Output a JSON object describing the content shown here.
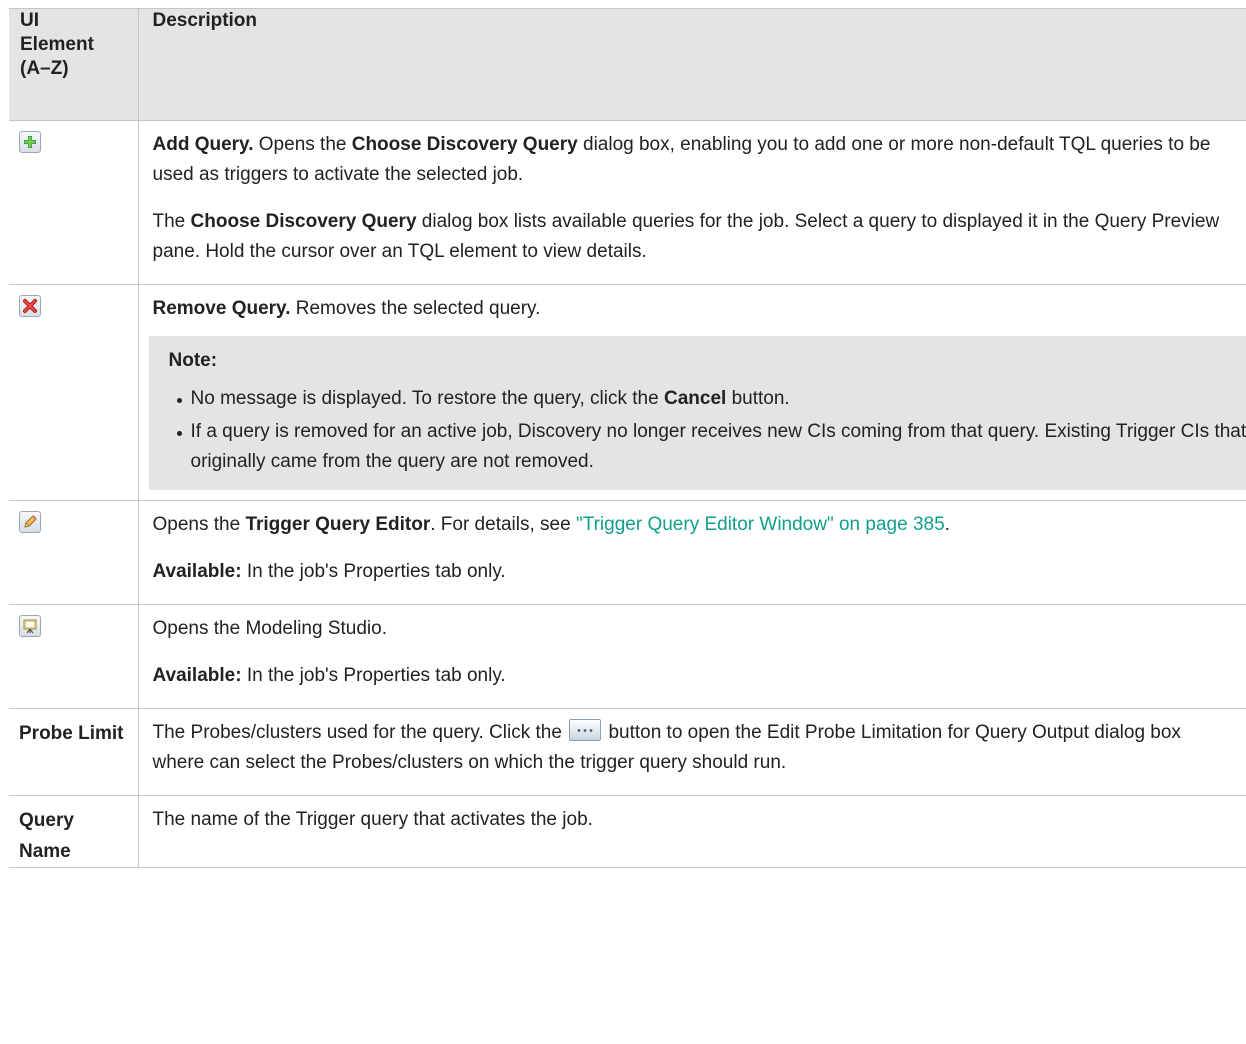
{
  "header": {
    "element_col": "UI Element (A–Z)",
    "description_col": "Description"
  },
  "rows": [
    {
      "icon": "add-query-icon",
      "lines": [
        {
          "segments": [
            {
              "t": "Add Query.",
              "b": true
            },
            {
              "t": " Opens the "
            },
            {
              "t": "Choose Discovery Query",
              "b": true
            },
            {
              "t": " dialog box, enabling you to add one or more non-default TQL queries to be used as triggers to activate the selected job."
            }
          ]
        },
        {
          "segments": [
            {
              "t": "The "
            },
            {
              "t": "Choose Discovery Query",
              "b": true
            },
            {
              "t": " dialog box lists available queries for the job. Select a query to displayed it in the Query Preview pane. Hold the cursor over an TQL element to view details."
            }
          ]
        }
      ]
    },
    {
      "icon": "remove-query-icon",
      "lines": [
        {
          "segments": [
            {
              "t": "Remove Query.",
              "b": true
            },
            {
              "t": " Removes the selected query."
            }
          ]
        }
      ],
      "note": {
        "title": "Note:",
        "items": [
          {
            "segments": [
              {
                "t": "No message is displayed. To restore the query, click the "
              },
              {
                "t": "Cancel",
                "b": true
              },
              {
                "t": " button."
              }
            ]
          },
          {
            "segments": [
              {
                "t": "If a query is removed for an active job, Discovery no longer receives new CIs coming from that query. Existing Trigger CIs that originally came from the query are not removed."
              }
            ]
          }
        ]
      }
    },
    {
      "icon": "edit-pencil-icon",
      "lines": [
        {
          "segments": [
            {
              "t": "Opens the "
            },
            {
              "t": "Trigger Query Editor",
              "b": true
            },
            {
              "t": ". For details, see "
            },
            {
              "t": "\"Trigger Query Editor Window\" on page 385",
              "link": true
            },
            {
              "t": "."
            }
          ]
        },
        {
          "segments": [
            {
              "t": "Available:",
              "b": true
            },
            {
              "t": " In the job's Properties tab only."
            }
          ]
        }
      ]
    },
    {
      "icon": "modeling-studio-icon",
      "lines": [
        {
          "segments": [
            {
              "t": "Opens the Modeling Studio."
            }
          ]
        },
        {
          "segments": [
            {
              "t": "Available:",
              "b": true
            },
            {
              "t": " In the job's Properties tab only."
            }
          ]
        }
      ]
    },
    {
      "label": "Probe Limit",
      "lines": [
        {
          "segments": [
            {
              "t": "The Probes/clusters used for the query. Click the "
            },
            {
              "button": "ellipsis-button"
            },
            {
              "t": " button to open the Edit Probe Limitation for Query Output dialog box where can select the Probes/clusters on which the trigger query should run."
            }
          ]
        }
      ]
    },
    {
      "label": "Query Name",
      "lines": [
        {
          "segments": [
            {
              "t": "The name of the Trigger query that activates the job."
            }
          ]
        }
      ]
    }
  ]
}
